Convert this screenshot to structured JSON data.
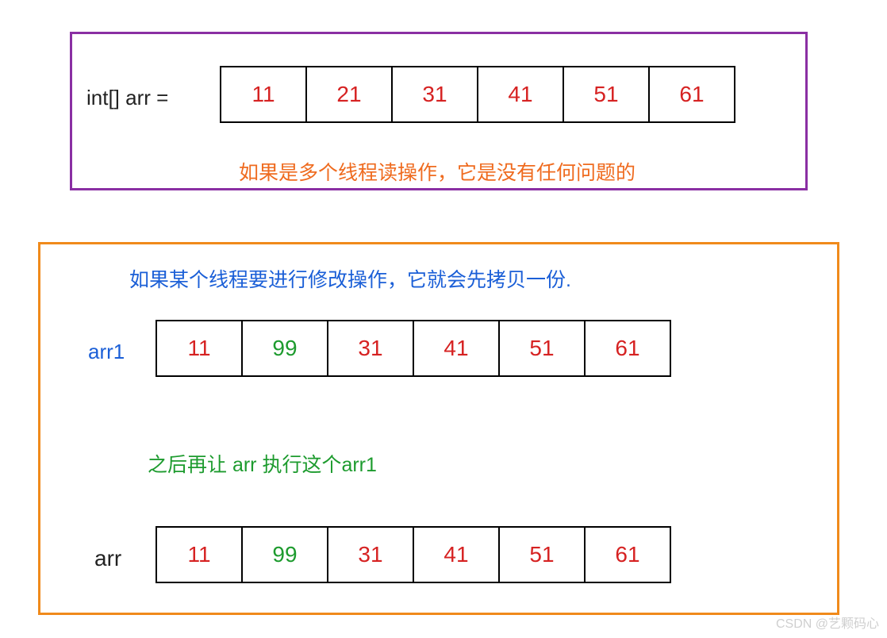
{
  "panel1": {
    "label": "int[] arr =",
    "cells": [
      "11",
      "21",
      "31",
      "41",
      "51",
      "61"
    ],
    "note": "如果是多个线程读操作，它是没有任何问题的"
  },
  "panel2": {
    "note_top": "如果某个线程要进行修改操作，它就会先拷贝一份.",
    "arr1_label": "arr1",
    "arr1_cells": [
      "11",
      "99",
      "31",
      "41",
      "51",
      "61"
    ],
    "note_mid": "之后再让 arr 执行这个arr1",
    "arr_label": "arr",
    "arr_cells": [
      "11",
      "99",
      "31",
      "41",
      "51",
      "61"
    ]
  },
  "watermark": "CSDN @艺颗码心",
  "chart_data": {
    "type": "table",
    "title": "CopyOnWrite array illustration",
    "arrays": [
      {
        "name": "int[] arr",
        "values": [
          11,
          21,
          31,
          41,
          51,
          61
        ],
        "modified_indexes": []
      },
      {
        "name": "arr1",
        "values": [
          11,
          99,
          31,
          41,
          51,
          61
        ],
        "modified_indexes": [
          1
        ]
      },
      {
        "name": "arr",
        "values": [
          11,
          99,
          31,
          41,
          51,
          61
        ],
        "modified_indexes": [
          1
        ]
      }
    ],
    "annotations": [
      "如果是多个线程读操作，它是没有任何问题的",
      "如果某个线程要进行修改操作，它就会先拷贝一份.",
      "之后再让 arr 执行这个arr1"
    ]
  }
}
